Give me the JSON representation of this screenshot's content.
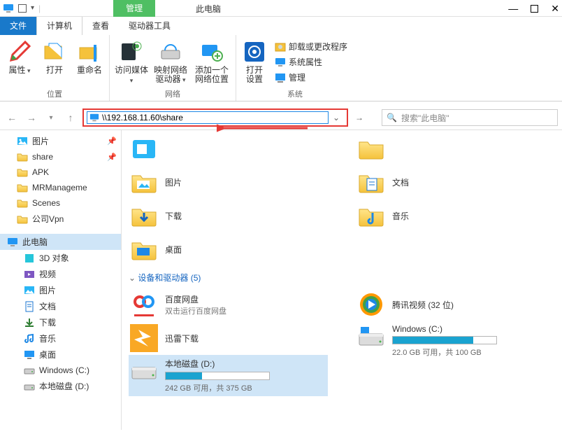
{
  "title": "此电脑",
  "title_tab": "管理",
  "tabs": {
    "file": "文件",
    "computer": "计算机",
    "view": "查看",
    "drive": "驱动器工具"
  },
  "ribbon": {
    "location": {
      "group": "位置",
      "props": "属性",
      "open": "打开",
      "rename": "重命名"
    },
    "network": {
      "group": "网络",
      "media": "访问媒体",
      "map": "映射网络\n驱动器",
      "add": "添加一个\n网络位置"
    },
    "system": {
      "group": "系统",
      "settings": "打开\n设置",
      "uninstall": "卸载或更改程序",
      "sysprops": "系统属性",
      "manage": "管理"
    }
  },
  "address": "\\\\192.168.11.60\\share",
  "search_placeholder": "搜索\"此电脑\"",
  "sidebar": {
    "quick": [
      {
        "label": "图片",
        "pin": true
      },
      {
        "label": "share",
        "pin": true
      },
      {
        "label": "APK"
      },
      {
        "label": "MRManageme"
      },
      {
        "label": "Scenes"
      },
      {
        "label": "公司Vpn"
      }
    ],
    "pc_label": "此电脑",
    "pc": [
      {
        "label": "3D 对象",
        "ic": "3d"
      },
      {
        "label": "视频",
        "ic": "video"
      },
      {
        "label": "图片",
        "ic": "picture"
      },
      {
        "label": "文档",
        "ic": "doc"
      },
      {
        "label": "下载",
        "ic": "download"
      },
      {
        "label": "音乐",
        "ic": "music"
      },
      {
        "label": "桌面",
        "ic": "desktop"
      },
      {
        "label": "Windows (C:)",
        "ic": "drive"
      },
      {
        "label": "本地磁盘 (D:)",
        "ic": "drive"
      }
    ]
  },
  "folders": {
    "left": [
      "图片",
      "下载",
      "桌面"
    ],
    "right": [
      "文档",
      "音乐"
    ]
  },
  "devices_header": "设备和驱动器 (5)",
  "devices": {
    "baidu": {
      "label": "百度网盘",
      "sub": "双击运行百度网盘"
    },
    "tencent": {
      "label": "腾讯视频 (32 位)"
    },
    "xunlei": {
      "label": "迅雷下载"
    },
    "c": {
      "label": "Windows (C:)",
      "sub": "22.0 GB 可用，共 100 GB",
      "pct": 78
    },
    "d": {
      "label": "本地磁盘 (D:)",
      "sub": "242 GB 可用，共 375 GB",
      "pct": 35
    }
  }
}
